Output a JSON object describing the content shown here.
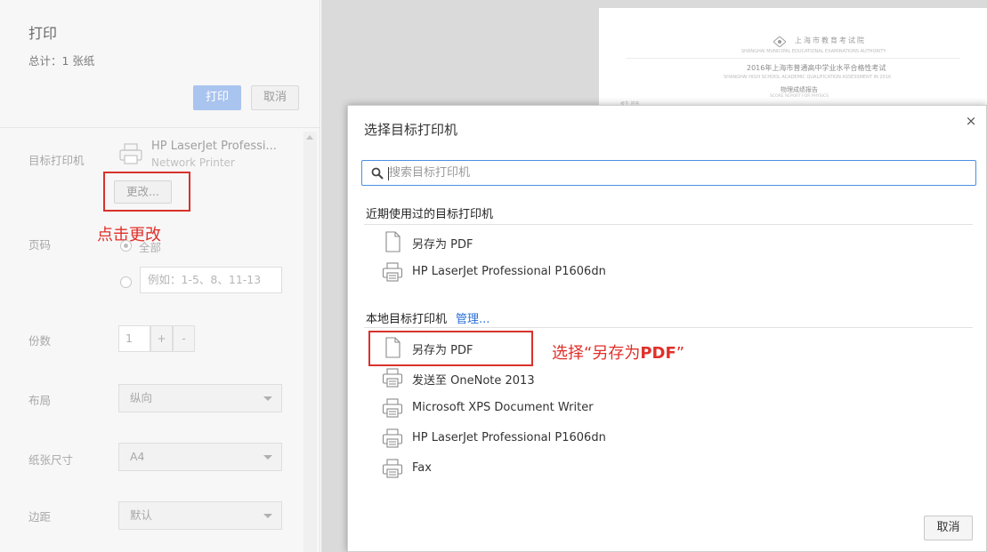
{
  "left_panel": {
    "title": "打印",
    "total": "总计：1 张纸",
    "print_button": "打印",
    "cancel_button": "取消",
    "destination_label": "目标打印机",
    "printer_name": "HP LaserJet Professi...",
    "printer_sub": "Network Printer",
    "change_button": "更改...",
    "annotation": "点击更改",
    "pages_label": "页码",
    "pages_all": "全部",
    "pages_custom_placeholder": "例如：1-5、8、11-13",
    "copies_label": "份数",
    "copies_value": "1",
    "copies_plus": "+",
    "copies_minus": "-",
    "layout_label": "布局",
    "layout_value": "纵向",
    "paper_label": "纸张尺寸",
    "paper_value": "A4",
    "margins_label": "边距",
    "margins_value": "默认"
  },
  "preview": {
    "header_cn": "上海市教育考试院",
    "header_en": "SHANGHAI MUNICIPAL EDUCATIONAL EXAMINATIONS AUTHORITY",
    "exam_title": "2016年上海市普通高中学业水平合格性考试",
    "exam_title_en": "SHANGHAI HIGH SCHOOL ACADEMIC QUALIFICATION ASSESSMENT IN 2016",
    "report_title": "物理成绩报告",
    "report_title_en": "SCORE REPORT FOR PHYSICS",
    "name_label": "考生 姓名"
  },
  "dialog": {
    "title": "选择目标打印机",
    "close": "×",
    "search_placeholder": "搜索目标打印机",
    "recent_header": "近期使用过的目标打印机",
    "recent_items": [
      {
        "label": "另存为 PDF",
        "icon": "document-icon"
      },
      {
        "label": "HP LaserJet Professional P1606dn",
        "icon": "printer-icon"
      }
    ],
    "local_header": "本地目标打印机",
    "manage_link": "管理...",
    "local_items": [
      {
        "label": "另存为 PDF",
        "icon": "document-icon"
      },
      {
        "label": "发送至 OneNote 2013",
        "icon": "printer-icon"
      },
      {
        "label": "Microsoft XPS Document Writer",
        "icon": "printer-icon"
      },
      {
        "label": "HP LaserJet Professional P1606dn",
        "icon": "printer-icon"
      },
      {
        "label": "Fax",
        "icon": "printer-icon"
      }
    ],
    "annotation_prefix": "选择“另存为",
    "annotation_bold": "PDF",
    "annotation_suffix": "”",
    "cancel_button": "取消"
  },
  "colors": {
    "annotation_red": "#e0302a",
    "link_blue": "#2a6fd6",
    "search_border": "#4a90e2"
  }
}
